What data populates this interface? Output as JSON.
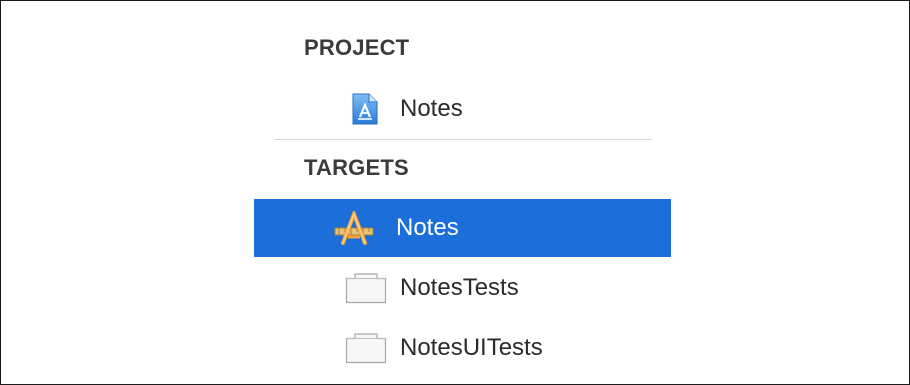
{
  "project_section": {
    "header": "PROJECT",
    "items": [
      {
        "label": "Notes",
        "icon": "project-file-icon",
        "selected": false
      }
    ]
  },
  "targets_section": {
    "header": "TARGETS",
    "items": [
      {
        "label": "Notes",
        "icon": "app-target-icon",
        "selected": true
      },
      {
        "label": "NotesTests",
        "icon": "test-bundle-icon",
        "selected": false
      },
      {
        "label": "NotesUITests",
        "icon": "test-bundle-icon",
        "selected": false
      }
    ]
  },
  "colors": {
    "selection": "#1c6fd9",
    "header_text": "#3b3b3b",
    "item_text": "#2b2b2b",
    "selected_text": "#ffffff"
  }
}
